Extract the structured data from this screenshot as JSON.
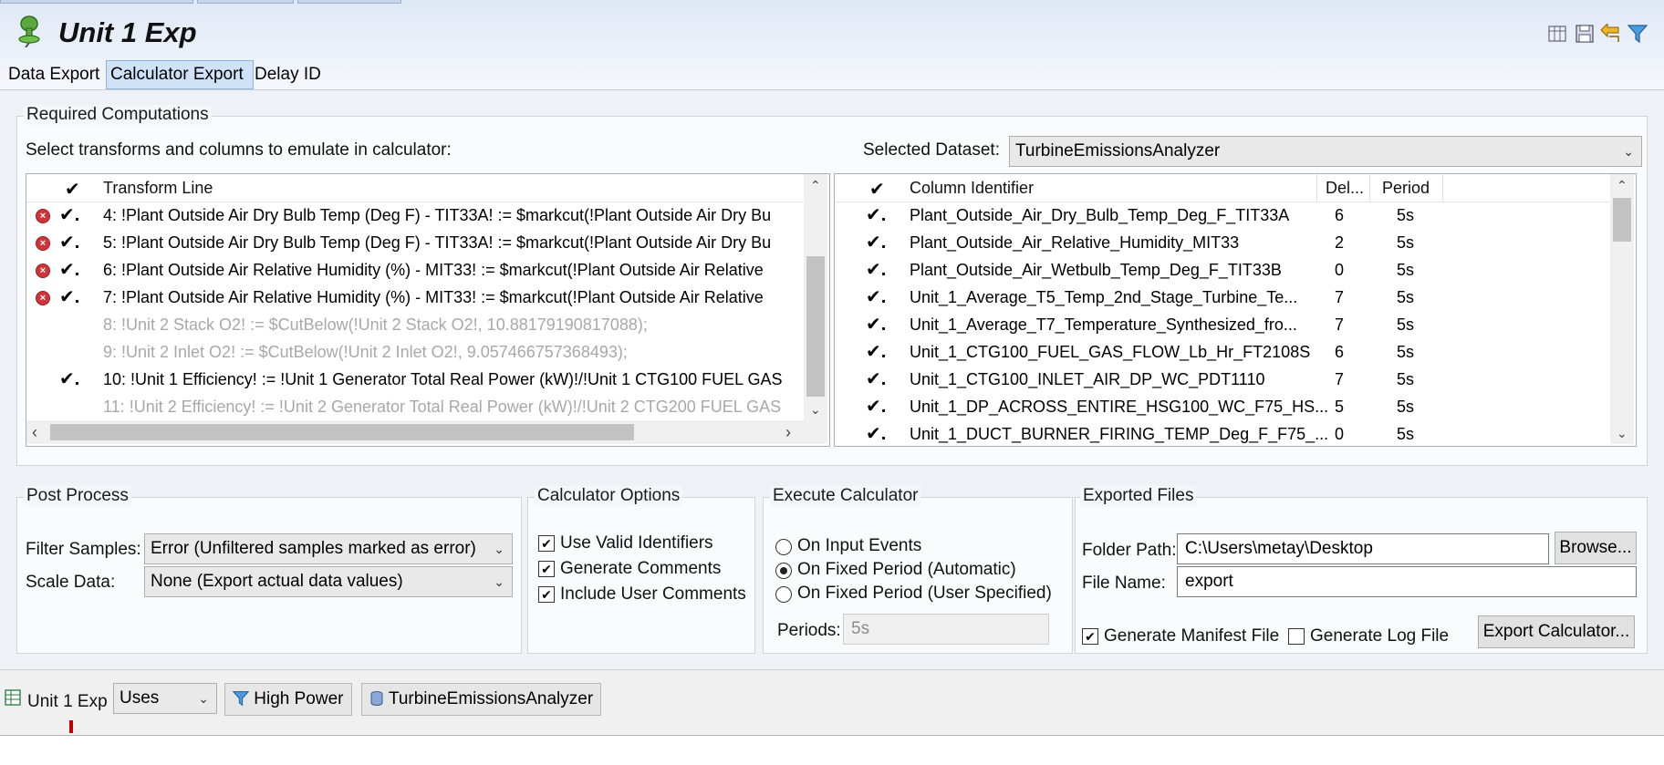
{
  "editor": {
    "title": "Unit 1 Exp",
    "icons": [
      "pin-icon",
      "columns-icon",
      "save-icon",
      "back-icon",
      "filter-icon"
    ]
  },
  "tabs": [
    "Data Export",
    "Calculator Export",
    "Delay ID"
  ],
  "required": {
    "group_label": "Required Computations",
    "instruction": "Select transforms and columns to emulate in calculator:",
    "dataset_label": "Selected Dataset:",
    "dataset_value": "TurbineEmissionsAnalyzer",
    "transforms": {
      "header": "Transform Line",
      "rows": [
        {
          "error": true,
          "checked": true,
          "dim": false,
          "text": "4: !Plant Outside Air Dry Bulb Temp (Deg F) - TIT33A! := $markcut(!Plant Outside Air Dry Bu"
        },
        {
          "error": true,
          "checked": true,
          "dim": false,
          "text": "5: !Plant Outside Air Dry Bulb Temp (Deg F) - TIT33A! := $markcut(!Plant Outside Air Dry Bu"
        },
        {
          "error": true,
          "checked": true,
          "dim": false,
          "text": "6: !Plant Outside Air Relative Humidity (%) - MIT33! := $markcut(!Plant Outside Air Relative"
        },
        {
          "error": true,
          "checked": true,
          "dim": false,
          "text": "7: !Plant Outside Air Relative Humidity (%) - MIT33! := $markcut(!Plant Outside Air Relative"
        },
        {
          "error": false,
          "checked": false,
          "dim": true,
          "text": "8: !Unit 2 Stack O2! := $CutBelow(!Unit 2 Stack O2!, 10.88179190817088);"
        },
        {
          "error": false,
          "checked": false,
          "dim": true,
          "text": "9: !Unit 2 Inlet O2! := $CutBelow(!Unit 2 Inlet O2!, 9.057466757368493);"
        },
        {
          "error": false,
          "checked": true,
          "dim": false,
          "text": "10: !Unit 1 Efficiency! := !Unit 1 Generator Total Real Power (kW)!/!Unit 1 CTG100 FUEL GAS"
        },
        {
          "error": false,
          "checked": false,
          "dim": true,
          "text": "11: !Unit 2 Efficiency! := !Unit 2 Generator Total Real Power (kW)!/!Unit 2 CTG200 FUEL GAS"
        }
      ]
    },
    "columns": {
      "headers": [
        "Column Identifier",
        "Del...",
        "Period"
      ],
      "rows": [
        {
          "checked": true,
          "id": "Plant_Outside_Air_Dry_Bulb_Temp_Deg_F_TIT33A",
          "delay": "6",
          "period": "5s"
        },
        {
          "checked": true,
          "id": "Plant_Outside_Air_Relative_Humidity_MIT33",
          "delay": "2",
          "period": "5s"
        },
        {
          "checked": true,
          "id": "Plant_Outside_Air_Wetbulb_Temp_Deg_F_TIT33B",
          "delay": "0",
          "period": "5s"
        },
        {
          "checked": true,
          "id": "Unit_1_Average_T5_Temp_2nd_Stage_Turbine_Te...",
          "delay": "7",
          "period": "5s"
        },
        {
          "checked": true,
          "id": "Unit_1_Average_T7_Temperature_Synthesized_fro...",
          "delay": "7",
          "period": "5s"
        },
        {
          "checked": true,
          "id": "Unit_1_CTG100_FUEL_GAS_FLOW_Lb_Hr_FT2108S",
          "delay": "6",
          "period": "5s"
        },
        {
          "checked": true,
          "id": "Unit_1_CTG100_INLET_AIR_DP_WC_PDT1110",
          "delay": "7",
          "period": "5s"
        },
        {
          "checked": true,
          "id": "Unit_1_DP_ACROSS_ENTIRE_HSG100_WC_F75_HS...",
          "delay": "5",
          "period": "5s"
        },
        {
          "checked": true,
          "id": "Unit_1_DUCT_BURNER_FIRING_TEMP_Deg_F_F75_...",
          "delay": "0",
          "period": "5s"
        }
      ]
    }
  },
  "post_process": {
    "group_label": "Post Process",
    "filter_label": "Filter Samples:",
    "filter_value": "Error (Unfiltered samples marked as error)",
    "scale_label": "Scale Data:",
    "scale_value": "None (Export actual data values)"
  },
  "calc_options": {
    "group_label": "Calculator Options",
    "options": [
      {
        "label": "Use Valid Identifiers",
        "checked": true
      },
      {
        "label": "Generate Comments",
        "checked": true
      },
      {
        "label": "Include User Comments",
        "checked": true
      }
    ]
  },
  "execute": {
    "group_label": "Execute Calculator",
    "options": [
      {
        "label": "On Input Events",
        "selected": false
      },
      {
        "label": "On Fixed Period (Automatic)",
        "selected": true
      },
      {
        "label": "On Fixed Period (User Specified)",
        "selected": false
      }
    ],
    "periods_label": "Periods:",
    "periods_value": "5s"
  },
  "exported": {
    "group_label": "Exported Files",
    "folder_label": "Folder Path:",
    "folder_value": "C:\\Users\\metay\\Desktop",
    "browse_label": "Browse...",
    "filename_label": "File Name:",
    "filename_value": "export",
    "manifest_label": "Generate Manifest File",
    "manifest_checked": true,
    "log_label": "Generate Log File",
    "log_checked": false,
    "export_label": "Export Calculator..."
  },
  "status_bar": {
    "doc_name": "Unit 1 Exp",
    "uses_value": "Uses",
    "filter_name": "High Power",
    "dataset_name": "TurbineEmissionsAnalyzer"
  }
}
